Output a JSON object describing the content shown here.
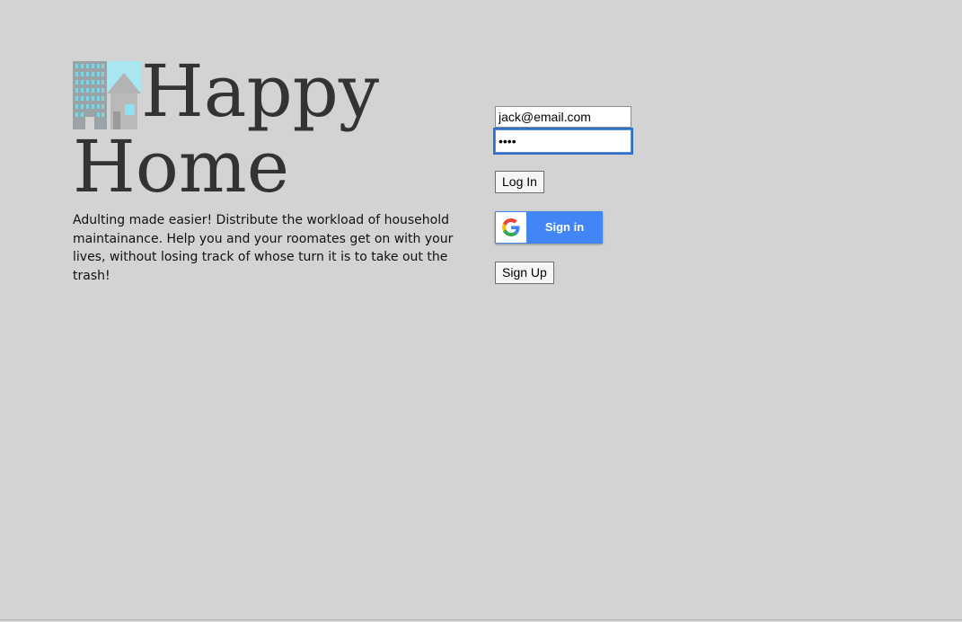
{
  "brand": {
    "title_line1": "Happy",
    "title_line2": "Home",
    "logo_icon": "building-house-logo",
    "tagline": "Adulting made easier! Distribute the workload of household maintainance. Help you and your roomates get on with your lives, without losing track of whose turn it is to take out the trash!"
  },
  "login": {
    "email_value": "jack@email.com",
    "password_value": "••••",
    "login_label": "Log In",
    "google_label": "Sign in",
    "google_icon": "google-g-icon",
    "signup_label": "Sign Up"
  },
  "colors": {
    "background": "#d3d3d3",
    "title": "#333333",
    "google_blue": "#4285f4",
    "focus_ring": "#2f6fca"
  }
}
